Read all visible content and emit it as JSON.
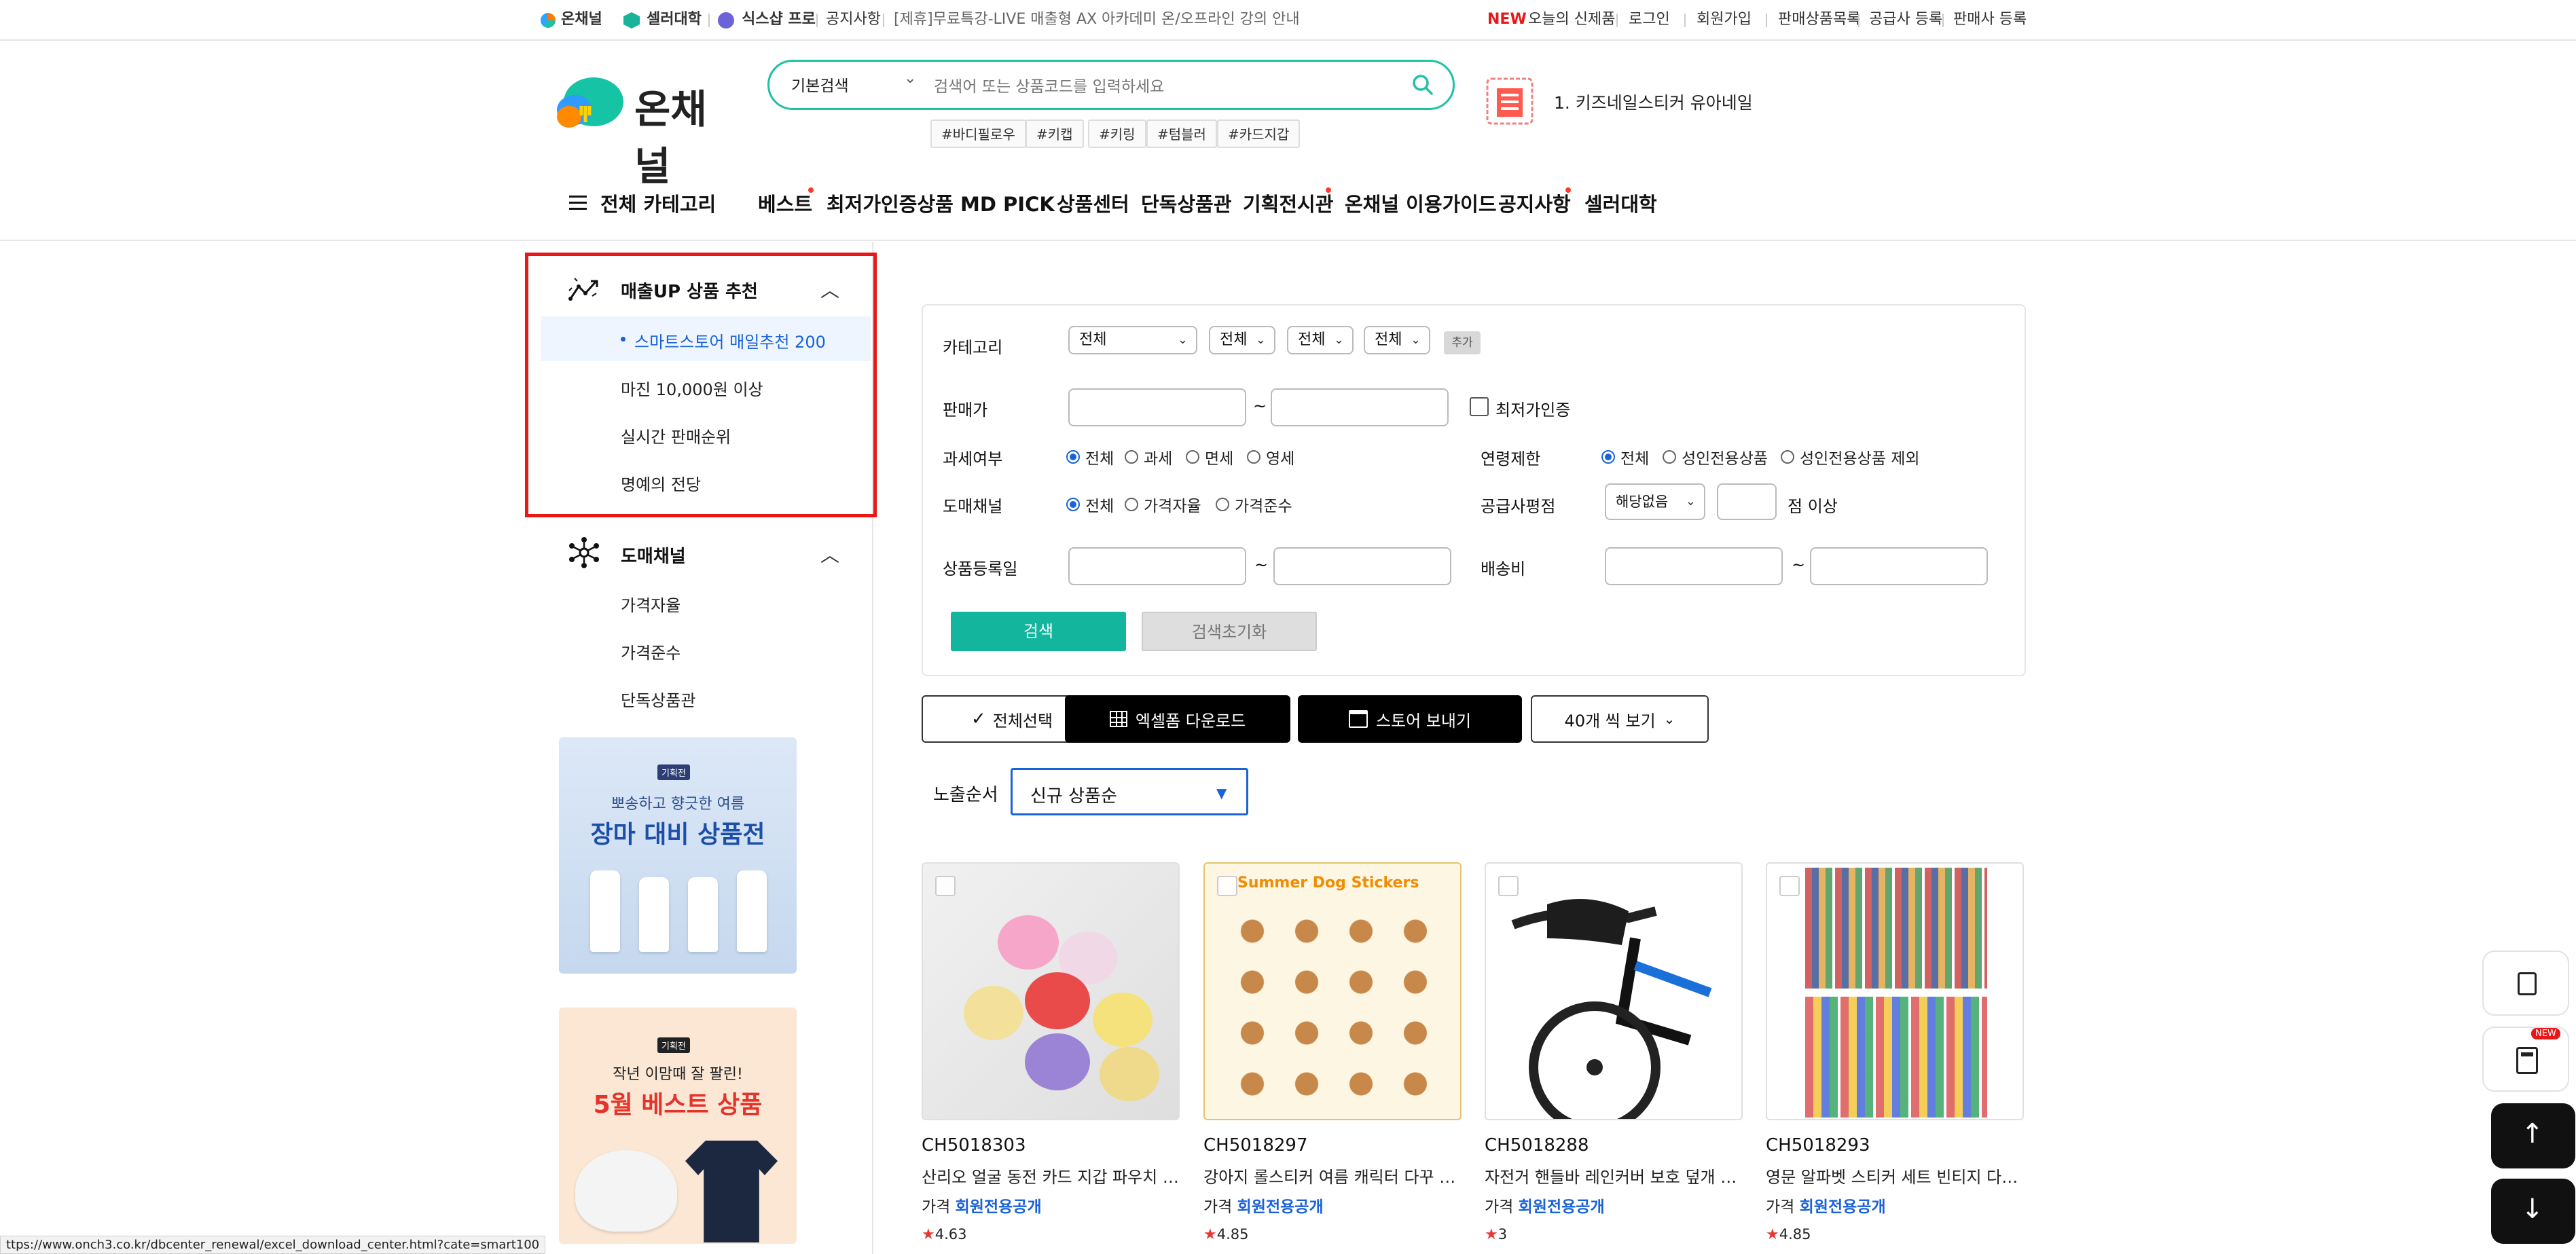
{
  "topbar": {
    "links_left": [
      "온채널",
      "셀러대학",
      "식스샵 프로",
      "공지사항"
    ],
    "notice": "[제휴]무료특강-LIVE 매출형 AX 아카데미 온/오프라인 강의 안내",
    "new_badge": "NEW",
    "links_right": [
      "오늘의 신제품",
      "로그인",
      "회원가입",
      "판매상품목록",
      "공급사 등록",
      "판매사 등록"
    ]
  },
  "header": {
    "logo": "온채널",
    "search_type": "기본검색",
    "search_placeholder": "검색어 또는 상품코드를 입력하세요",
    "tags": [
      "#바디필로우",
      "#키캡",
      "#키링",
      "#텀블러",
      "#카드지갑"
    ],
    "ranking": "1. 키즈네일스티커 유아네일"
  },
  "nav": {
    "all_category": "전체 카테고리",
    "items": [
      "베스트",
      "최저가인증상품",
      "MD PICK",
      "상품센터",
      "단독상품관",
      "기획전시관",
      "온채널 이용가이드",
      "공지사항",
      "셀러대학"
    ]
  },
  "sidebar": {
    "section1_title": "매출UP 상품 추천",
    "section1_items": [
      "스마트스토어 매일추천 200",
      "마진 10,000원 이상",
      "실시간 판매순위",
      "명예의 전당"
    ],
    "section2_title": "도매채널",
    "section2_items": [
      "가격자율",
      "가격준수",
      "단독상품관"
    ],
    "banner1": {
      "badge": "기획전",
      "line1": "뽀송하고 향긋한 여름",
      "line2": "장마 대비 상품전"
    },
    "banner2": {
      "badge": "기획전",
      "line1": "작년 이맘때 잘 팔린!",
      "line2": "5월 베스트 상품"
    }
  },
  "filter": {
    "category_label": "카테고리",
    "category_selects": [
      "전체",
      "전체",
      "전체",
      "전체"
    ],
    "add_button": "추가",
    "price_label": "판매가",
    "tilde": "~",
    "lowest_label": "최저가인증",
    "tax_label": "과세여부",
    "tax_options": [
      "전체",
      "과세",
      "면세",
      "영세"
    ],
    "age_label": "연령제한",
    "age_options": [
      "전체",
      "성인전용상품",
      "성인전용상품 제외"
    ],
    "channel_label": "도매채널",
    "channel_options": [
      "전체",
      "가격자율",
      "가격준수"
    ],
    "rating_label": "공급사평점",
    "rating_select": "해당없음",
    "rating_suffix": "점 이상",
    "date_label": "상품등록일",
    "shipping_label": "배송비",
    "search_button": "검색",
    "reset_button": "검색초기화"
  },
  "actions": {
    "select_all": "전체선택",
    "excel": "엑셀폼 다운로드",
    "store_send": "스토어 보내기",
    "per_page": "40개 씩 보기"
  },
  "sort": {
    "label": "노출순서",
    "value": "신규 상품순"
  },
  "products": [
    {
      "code": "CH5018303",
      "name": "산리오 얼굴 동전 카드 지갑 파우치 키...",
      "price_label": "가격",
      "price": "회원전용공개",
      "rating": "4.63"
    },
    {
      "code": "CH5018297",
      "name": "강아지 롤스티커 여름 캐릭터 다꾸 귀...",
      "price_label": "가격",
      "price": "회원전용공개",
      "rating": "4.85",
      "image_text": "Summer Dog Stickers"
    },
    {
      "code": "CH5018288",
      "name": "자전거 핸들바 레인커버 보호 덮개 방...",
      "price_label": "가격",
      "price": "회원전용공개",
      "rating": "3"
    },
    {
      "code": "CH5018293",
      "name": "영문 알파벳 스티커 세트 빈티지 다이...",
      "price_label": "가격",
      "price": "회원전용공개",
      "rating": "4.85"
    }
  ],
  "float": {
    "new_badge": "NEW"
  },
  "status_url": "ttps://www.onch3.co.kr/dbcenter_renewal/excel_download_center.html?cate=smart100",
  "colors": {
    "accent": "#1ec0a8",
    "primary_blue": "#1a62d8",
    "highlight": "#e81818",
    "dark": "#000000"
  }
}
